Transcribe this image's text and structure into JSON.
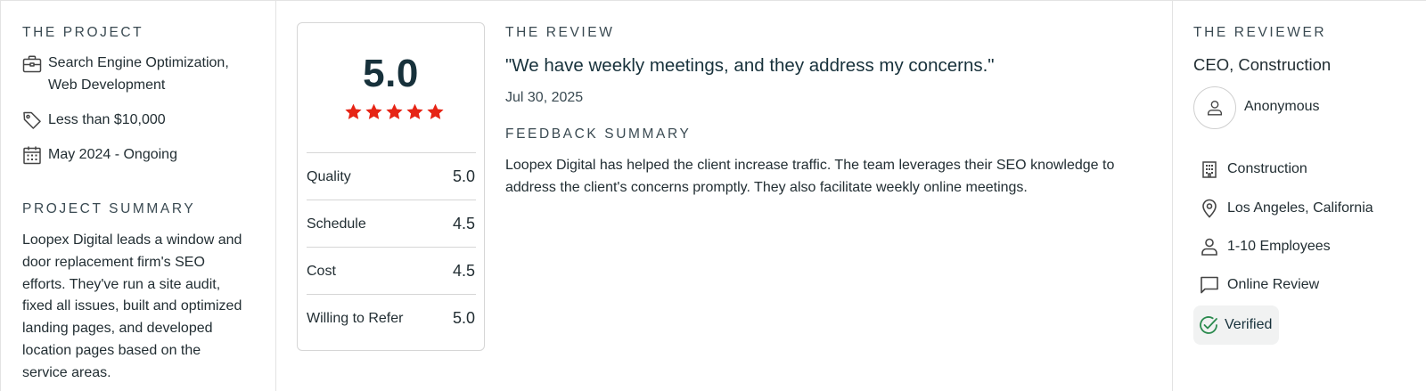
{
  "project": {
    "heading": "THE PROJECT",
    "service_line1": "Search Engine Optimization,",
    "service_line2": "Web Development",
    "budget": "Less than $10,000",
    "timeline": "May 2024 - Ongoing",
    "icons": [
      "briefcase-icon",
      "price-tag-icon",
      "calendar-icon"
    ]
  },
  "project_summary": {
    "heading": "PROJECT SUMMARY",
    "lines": [
      "Loopex Digital leads a window and",
      "door replacement firm's SEO",
      "efforts. They've run a site audit,",
      "fixed all issues, built and optimized",
      "landing pages, and developed",
      "location pages based on the",
      "service areas."
    ]
  },
  "rating": {
    "overall": "5.0",
    "stars": 5,
    "star_color": "#e62415",
    "rows": [
      {
        "label": "Quality",
        "value": "5.0"
      },
      {
        "label": "Schedule",
        "value": "4.5"
      },
      {
        "label": "Cost",
        "value": "4.5"
      },
      {
        "label": "Willing to Refer",
        "value": "5.0"
      }
    ]
  },
  "review": {
    "heading": "THE REVIEW",
    "quote": "\"We have weekly meetings, and they address my concerns.\"",
    "date": "Jul 30, 2025",
    "feedback_heading": "FEEDBACK SUMMARY",
    "feedback_lines": [
      "Loopex Digital has helped the client increase traffic. The team leverages their SEO knowledge to",
      "address the client's concerns promptly. They also facilitate weekly online meetings."
    ]
  },
  "reviewer": {
    "heading": "THE REVIEWER",
    "role": "CEO, Construction",
    "name": "Anonymous",
    "details": [
      {
        "icon": "building-icon",
        "text": "Construction"
      },
      {
        "icon": "location-pin-icon",
        "text": "Los Angeles, California"
      },
      {
        "icon": "person-icon",
        "text": "1-10 Employees"
      },
      {
        "icon": "chat-bubble-icon",
        "text": "Online Review"
      }
    ],
    "verified": "Verified",
    "verified_color": "#2b8a4e"
  }
}
